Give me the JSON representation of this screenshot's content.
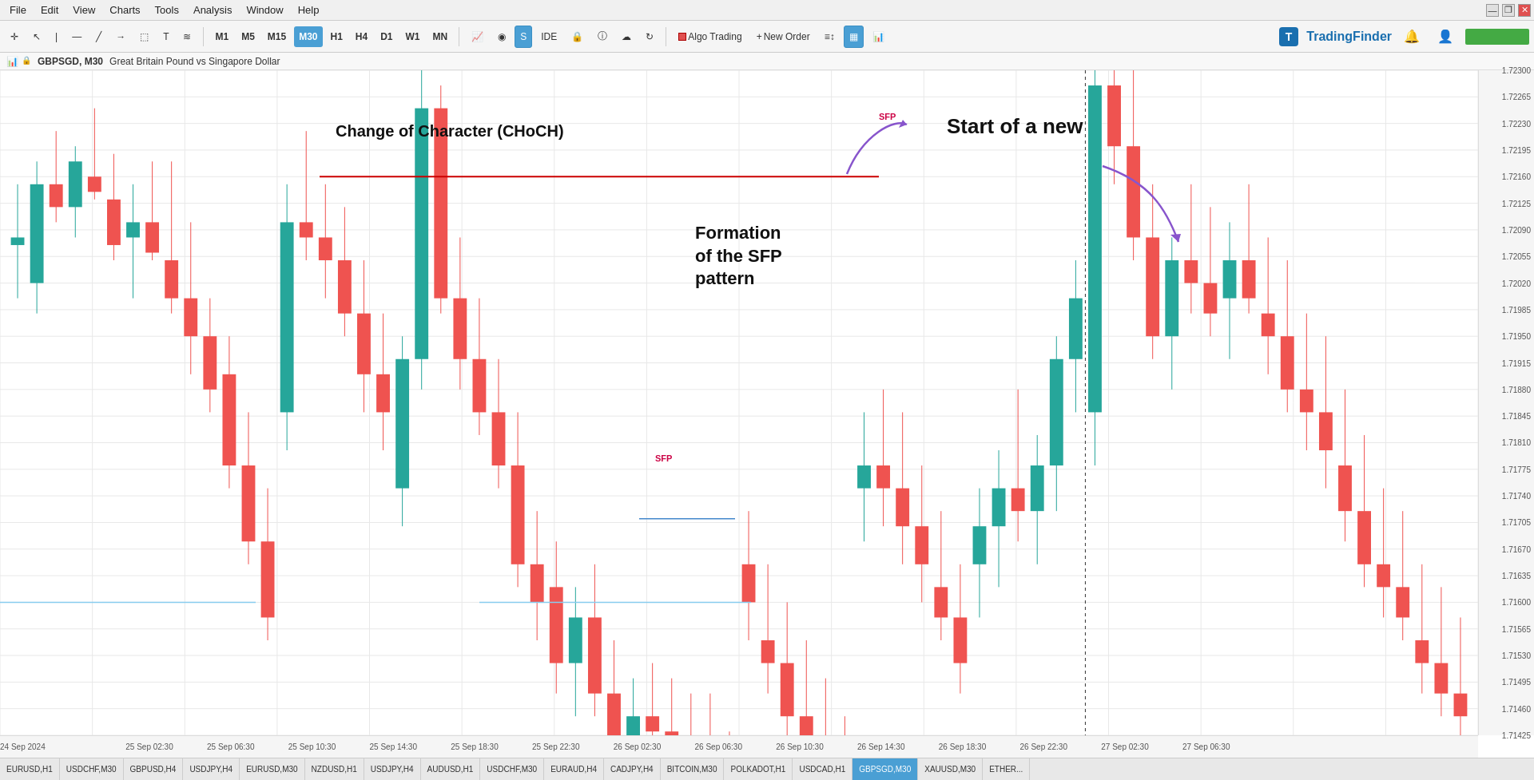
{
  "menu": {
    "items": [
      "File",
      "Edit",
      "View",
      "Charts",
      "Tools",
      "Analysis",
      "Window",
      "Help"
    ]
  },
  "toolbar": {
    "periods": [
      "M1",
      "M5",
      "M15",
      "M30",
      "H1",
      "H4",
      "D1",
      "W1",
      "MN"
    ],
    "active_period": "M30",
    "buttons": [
      "Algo Trading",
      "New Order"
    ],
    "logo": "TradingFinder"
  },
  "chart": {
    "symbol": "GBPSGD",
    "timeframe": "M30",
    "description": "Great Britain Pound vs Singapore Dollar",
    "price_high": 1.723,
    "price_low": 1.71425,
    "annotations": {
      "choch": "Change of Character (CHoCH)",
      "sfp_formation": "Formation\nof the SFP\npattern",
      "new_start": "Start of a new",
      "sfp_label_top": "SFP",
      "sfp_label_bottom": "SFP"
    },
    "price_labels": [
      "1.72300",
      "1.72265",
      "1.72230",
      "1.72195",
      "1.72160",
      "1.72125",
      "1.72090",
      "1.72055",
      "1.72020",
      "1.71985",
      "1.71950",
      "1.71915",
      "1.71880",
      "1.71845",
      "1.71810",
      "1.71775",
      "1.71740",
      "1.71705",
      "1.71670",
      "1.71635",
      "1.71600",
      "1.71565",
      "1.71530",
      "1.71495",
      "1.71460",
      "1.71425"
    ],
    "time_labels": [
      {
        "label": "24 Sep 2024",
        "pos": 0
      },
      {
        "label": "25 Sep 02:30",
        "pos": 8.5
      },
      {
        "label": "25 Sep 06:30",
        "pos": 14
      },
      {
        "label": "25 Sep 10:30",
        "pos": 19.5
      },
      {
        "label": "25 Sep 14:30",
        "pos": 25
      },
      {
        "label": "25 Sep 18:30",
        "pos": 30.5
      },
      {
        "label": "25 Sep 22:30",
        "pos": 36
      },
      {
        "label": "26 Sep 02:30",
        "pos": 41.5
      },
      {
        "label": "26 Sep 06:30",
        "pos": 47
      },
      {
        "label": "26 Sep 10:30",
        "pos": 52.5
      },
      {
        "label": "26 Sep 14:30",
        "pos": 58
      },
      {
        "label": "26 Sep 18:30",
        "pos": 63.5
      },
      {
        "label": "26 Sep 22:30",
        "pos": 69
      },
      {
        "label": "27 Sep 02:30",
        "pos": 74.5
      },
      {
        "label": "27 Sep 06:30",
        "pos": 80
      }
    ]
  },
  "symbol_tabs": [
    {
      "label": "EURUSD,H1",
      "active": false
    },
    {
      "label": "USDCHF,M30",
      "active": false
    },
    {
      "label": "GBPUSD,H4",
      "active": false
    },
    {
      "label": "USDJPY,H4",
      "active": false
    },
    {
      "label": "EURUSD,M30",
      "active": false
    },
    {
      "label": "NZDUSD,H1",
      "active": false
    },
    {
      "label": "USDJPY,H4",
      "active": false
    },
    {
      "label": "AUDUSD,H1",
      "active": false
    },
    {
      "label": "USDCHF,M30",
      "active": false
    },
    {
      "label": "EURAUD,H4",
      "active": false
    },
    {
      "label": "CADJPY,H4",
      "active": false
    },
    {
      "label": "BITCOIN,M30",
      "active": false
    },
    {
      "label": "POLKADOT,H1",
      "active": false
    },
    {
      "label": "USDCAD,H1",
      "active": false
    },
    {
      "label": "GBPSGD,M30",
      "active": true
    },
    {
      "label": "XAUUSD,M30",
      "active": false
    },
    {
      "label": "ETHER...",
      "active": false
    }
  ]
}
